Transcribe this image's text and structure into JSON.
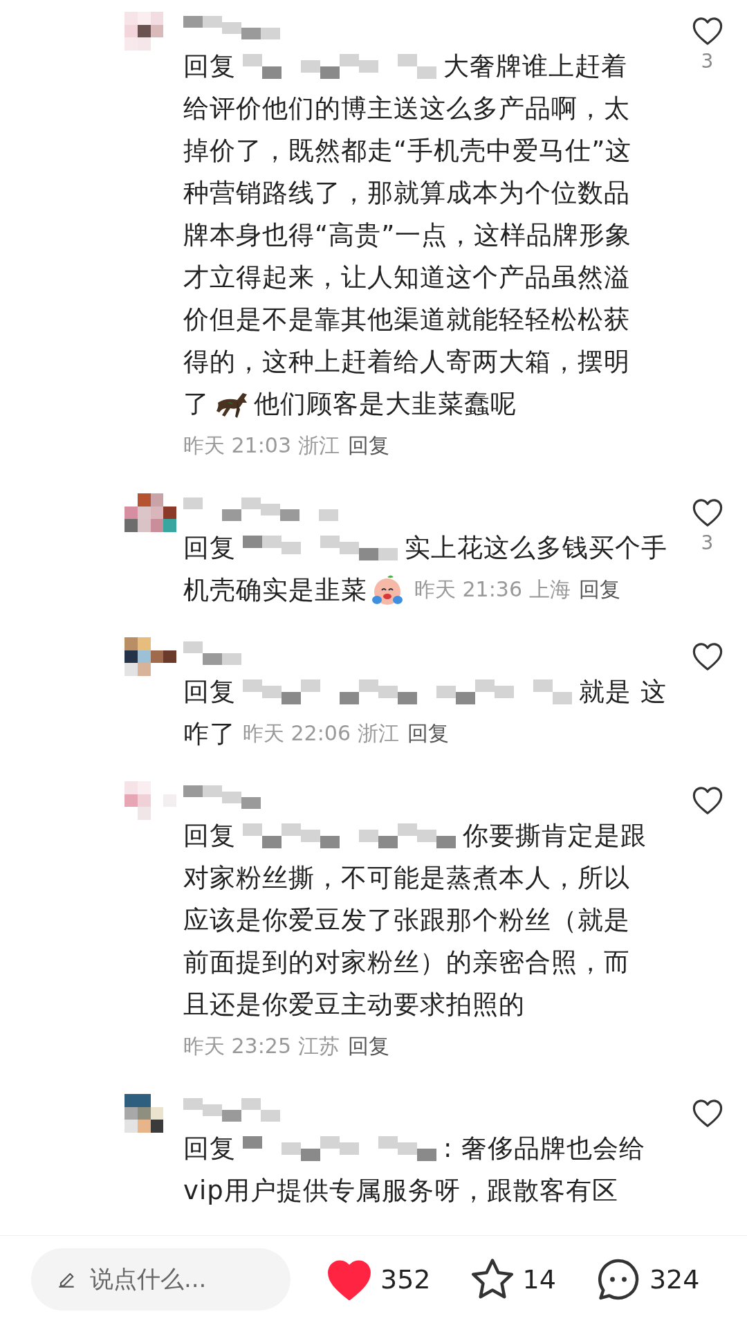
{
  "comments": [
    {
      "likes": "3",
      "meta_inline": false,
      "lines": [
        [
          {
            "kind": "text",
            "text": "回复"
          },
          {
            "kind": "mask"
          },
          {
            "kind": "text",
            "text": "大奢牌谁上赶着"
          }
        ],
        [
          {
            "kind": "text",
            "text": "给评价他们的博主送这么多产品啊，太"
          }
        ],
        [
          {
            "kind": "text",
            "text": "掉价了，既然都走“手机壳中爱马仕”这"
          }
        ],
        [
          {
            "kind": "text",
            "text": "种营销路线了，那就算成本为个位数品"
          }
        ],
        [
          {
            "kind": "text",
            "text": "牌本身也得“高贵”一点，这样品牌形象"
          }
        ],
        [
          {
            "kind": "text",
            "text": "才立得起来，让人知道这个产品虽然溢"
          }
        ],
        [
          {
            "kind": "text",
            "text": "价但是不是靠其他渠道就能轻轻松松获"
          }
        ],
        [
          {
            "kind": "text",
            "text": "得的，这种上赶着给人寄两大箱，摆明"
          }
        ],
        [
          {
            "kind": "text",
            "text": "了"
          },
          {
            "kind": "horse"
          },
          {
            "kind": "text",
            "text": "他们顾客是大韭菜蠢呢"
          }
        ]
      ],
      "meta": {
        "info": "昨天 21:03 浙江",
        "reply": "回复"
      }
    },
    {
      "likes": "3",
      "meta_inline": true,
      "lines": [
        [
          {
            "kind": "text",
            "text": "回复"
          },
          {
            "kind": "mask"
          },
          {
            "kind": "text",
            "text": "实上花这么多钱买个手"
          }
        ],
        [
          {
            "kind": "text",
            "text": "机壳确实是韭菜"
          },
          {
            "kind": "crying"
          }
        ]
      ],
      "meta": {
        "info": "昨天 21:36 上海",
        "reply": "回复"
      }
    },
    {
      "meta_inline": true,
      "lines": [
        [
          {
            "kind": "text",
            "text": "回复"
          },
          {
            "kind": "mask"
          },
          {
            "kind": "text",
            "text": "就是 这"
          }
        ],
        [
          {
            "kind": "text",
            "text": "咋了"
          }
        ]
      ],
      "meta": {
        "info": "昨天 22:06 浙江",
        "reply": "回复"
      }
    },
    {
      "meta_inline": false,
      "lines": [
        [
          {
            "kind": "text",
            "text": "回复"
          },
          {
            "kind": "mask"
          },
          {
            "kind": "text",
            "text": "你要撕肯定是跟"
          }
        ],
        [
          {
            "kind": "text",
            "text": "对家粉丝撕，不可能是蒸煮本人，所以"
          }
        ],
        [
          {
            "kind": "text",
            "text": "应该是你爱豆发了张跟那个粉丝（就是"
          }
        ],
        [
          {
            "kind": "text",
            "text": "前面提到的对家粉丝）的亲密合照，而"
          }
        ],
        [
          {
            "kind": "text",
            "text": "且还是你爱豆主动要求拍照的"
          }
        ]
      ],
      "meta": {
        "info": "昨天 23:25 江苏",
        "reply": "回复"
      }
    },
    {
      "lines": [
        [
          {
            "kind": "text",
            "text": "回复"
          },
          {
            "kind": "mask"
          },
          {
            "kind": "text",
            "text": ": 奢侈品牌也会给"
          }
        ],
        [
          {
            "kind": "text",
            "text": "vip用户提供专属服务呀，跟散客有区"
          }
        ]
      ]
    }
  ],
  "bottom_bar": {
    "placeholder": "说点什么...",
    "likes": "352",
    "liked": true,
    "stars": "14",
    "starred": false,
    "comments": "324"
  }
}
